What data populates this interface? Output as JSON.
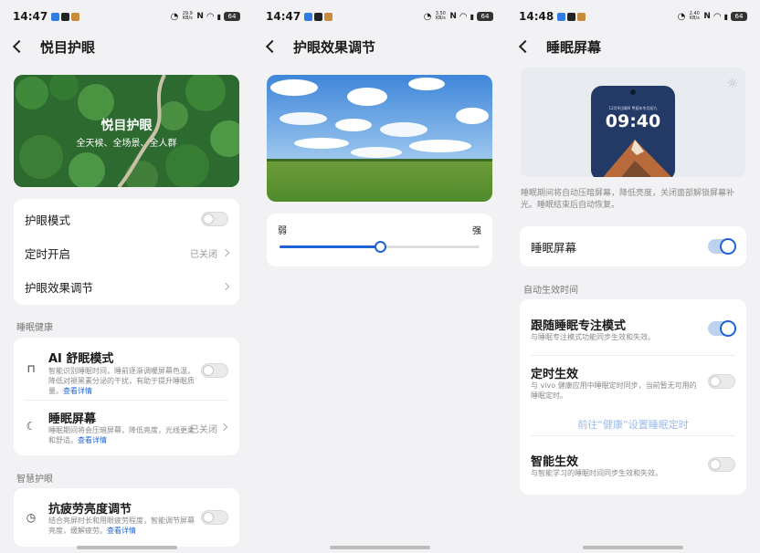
{
  "panels": [
    {
      "status": {
        "time": "14:47",
        "speed": "29.9\nKB/s",
        "battery": "64"
      },
      "title": "悦目护眼",
      "banner": {
        "title": "悦目护眼",
        "subtitle": "全天候、全场景、全人群"
      },
      "settings": [
        {
          "label": "护眼模式"
        },
        {
          "label": "定时开启",
          "value": "已关闭"
        },
        {
          "label": "护眼效果调节"
        }
      ],
      "section_sleep": "睡眠健康",
      "ai_sleep": {
        "title": "AI 舒眠模式",
        "desc": "智能识别睡眠时间，睡前逐渐调暖屏幕色温，降低对褪黑素分泌的干扰，有助于提升睡眠质量。",
        "link": "查看详情"
      },
      "sleep_screen": {
        "title": "睡眠屏幕",
        "desc": "睡眠期间将会压暗屏幕，降低亮度，光线更柔和舒适。",
        "link": "查看详情",
        "value": "已关闭"
      },
      "section_smart": "智慧护眼",
      "anti_fatigue": {
        "title": "抗疲劳亮度调节",
        "desc": "结合亮屏时长和用眼疲劳程度，智能调节屏幕亮度，缓解疲劳。",
        "link": "查看详情"
      }
    },
    {
      "status": {
        "time": "14:47",
        "speed": "3.50\nKB/s",
        "battery": "64"
      },
      "title": "护眼效果调节",
      "slider": {
        "min_label": "弱",
        "max_label": "强",
        "value": 0.5
      }
    },
    {
      "status": {
        "time": "14:48",
        "speed": "2.40\nKB/s",
        "battery": "64"
      },
      "title": "睡眠屏幕",
      "preview": {
        "date": "12月9日周四 甲辰年冬月初九",
        "time": "09:40"
      },
      "desc": "睡眠期间将自动压暗屏幕，降低亮度，关闭面部解锁屏幕补光。睡眠结束后自动恢复。",
      "main_toggle": {
        "label": "睡眠屏幕",
        "on": true
      },
      "section_auto": "自动生效时间",
      "follow": {
        "title": "跟随睡眠专注模式",
        "desc": "与睡眠专注模式功能同步生效和失效。",
        "on": true
      },
      "timed": {
        "title": "定时生效",
        "desc": "与 vivo 健康应用中睡眠定时同步，当前暂无可用的睡眠定时。",
        "on": false
      },
      "goto_link": "前往“健康”设置睡眠定时",
      "smart": {
        "title": "智能生效",
        "desc": "与智能学习的睡眠时间同步生效和失效。",
        "on": false
      }
    }
  ],
  "colors": {
    "accent": "#1f63d6",
    "toggle_on_track": "#bcd2ee",
    "bg": "#f2f2f4"
  }
}
